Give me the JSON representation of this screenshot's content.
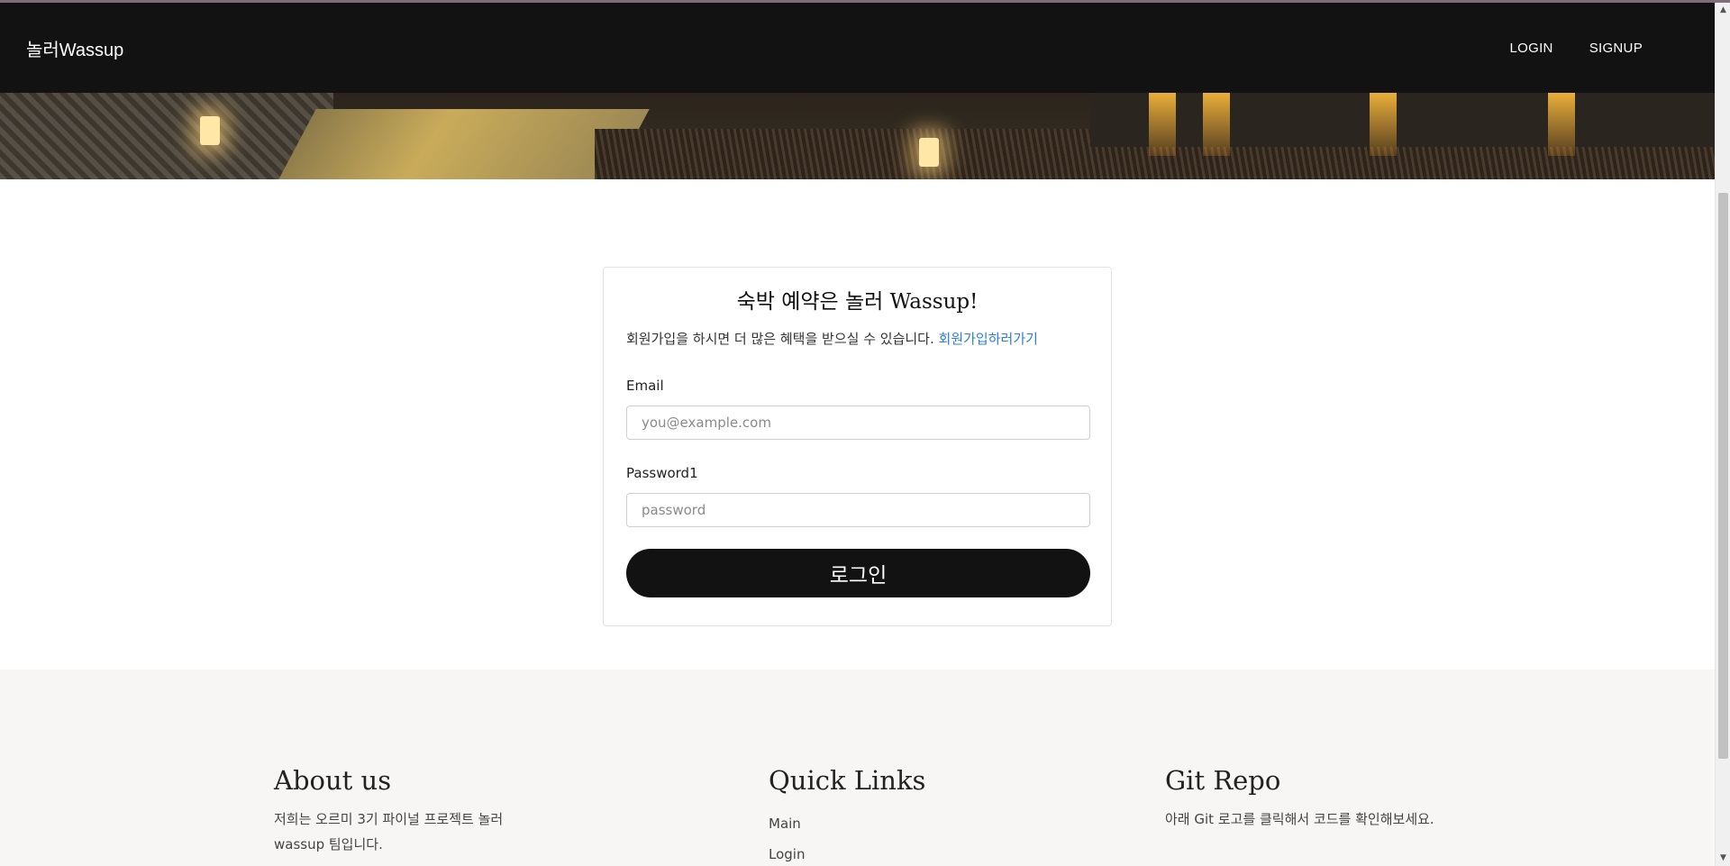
{
  "nav": {
    "brand": "놀러Wassup",
    "login": "LOGIN",
    "signup": "SIGNUP"
  },
  "login_card": {
    "title": "숙박 예약은 놀러 Wassup!",
    "subtitle": "회원가입을 하시면 더 많은 혜택을 받으실 수 있습니다.",
    "signup_link": "회원가입하러가기",
    "email_label": "Email",
    "email_placeholder": "you@example.com",
    "password_label": "Password1",
    "password_placeholder": "password",
    "submit_label": "로그인"
  },
  "footer": {
    "about": {
      "title": "About us",
      "text": "저희는 오르미 3기 파이널 프로젝트 놀러 wassup 팀입니다."
    },
    "quick_links": {
      "title": "Quick Links",
      "items": [
        "Main",
        "Login"
      ]
    },
    "git_repo": {
      "title": "Git Repo",
      "text": "아래 Git 로고를 클릭해서 코드를 확인해보세요."
    }
  },
  "icons": {
    "scroll_up": "scroll-up-arrow",
    "scroll_down": "scroll-down-arrow"
  }
}
